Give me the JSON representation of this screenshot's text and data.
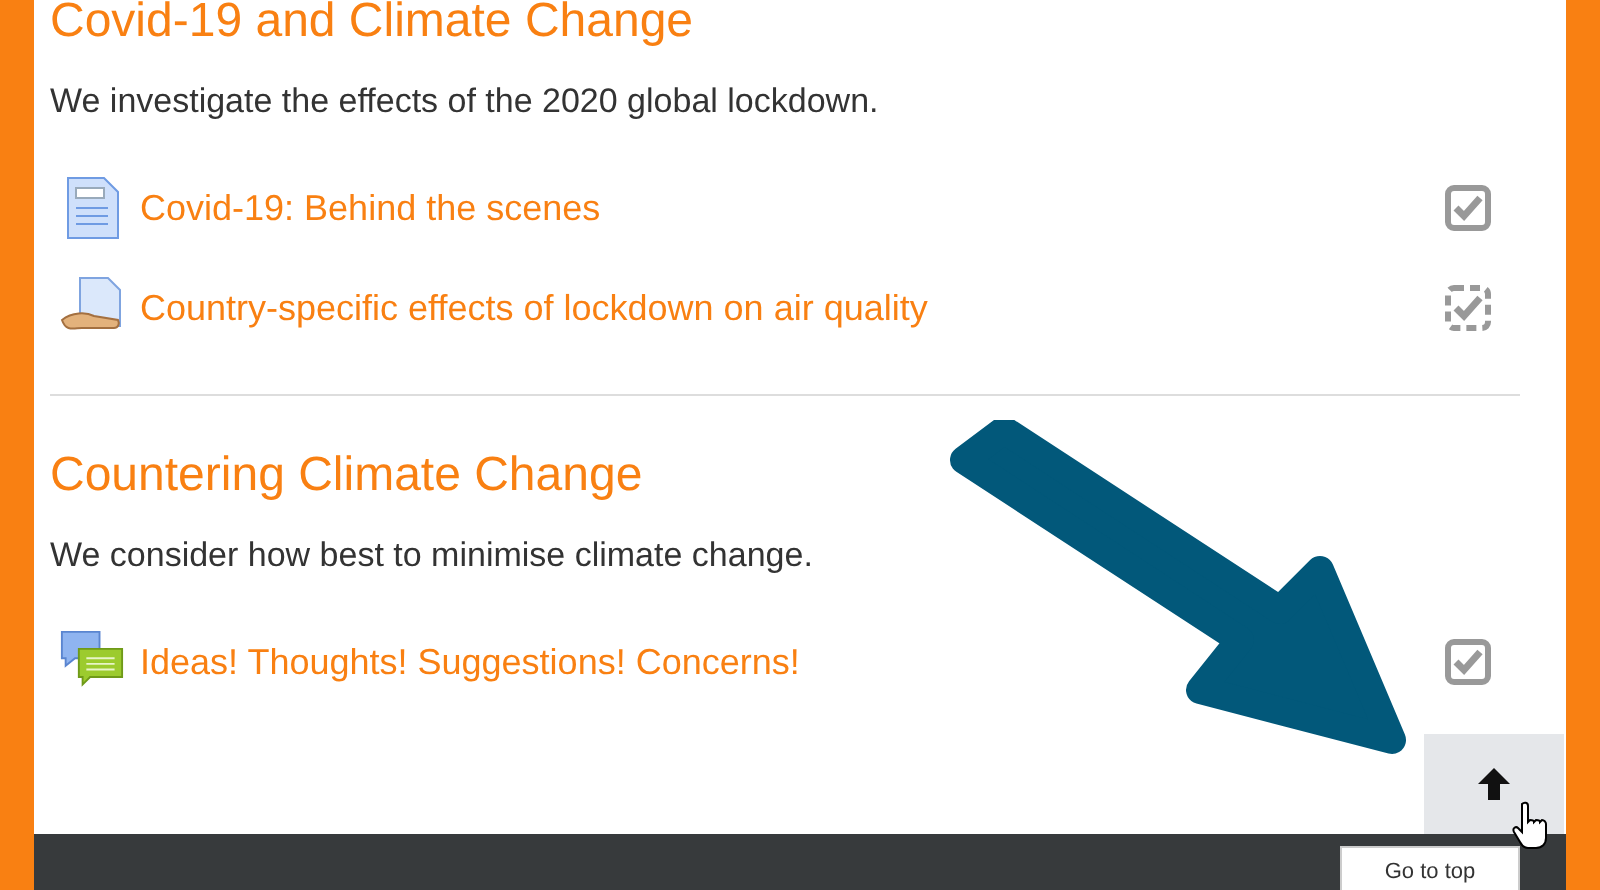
{
  "sections": [
    {
      "title": "Covid-19 and Climate Change",
      "summary": "We investigate the effects of the 2020 global lockdown.",
      "activities": [
        {
          "kind": "page",
          "label": "Covid-19: Behind the scenes",
          "automatic": false,
          "checked": true
        },
        {
          "kind": "url",
          "label": "Country-specific effects of lockdown on air quality",
          "automatic": true,
          "checked": true
        }
      ]
    },
    {
      "title": "Countering Climate Change",
      "summary": "We consider how best to minimise climate change.",
      "activities": [
        {
          "kind": "forum",
          "label": "Ideas! Thoughts! Suggestions! Concerns!",
          "automatic": false,
          "checked": true
        }
      ]
    }
  ],
  "back_to_top": {
    "tooltip": "Go to top"
  }
}
